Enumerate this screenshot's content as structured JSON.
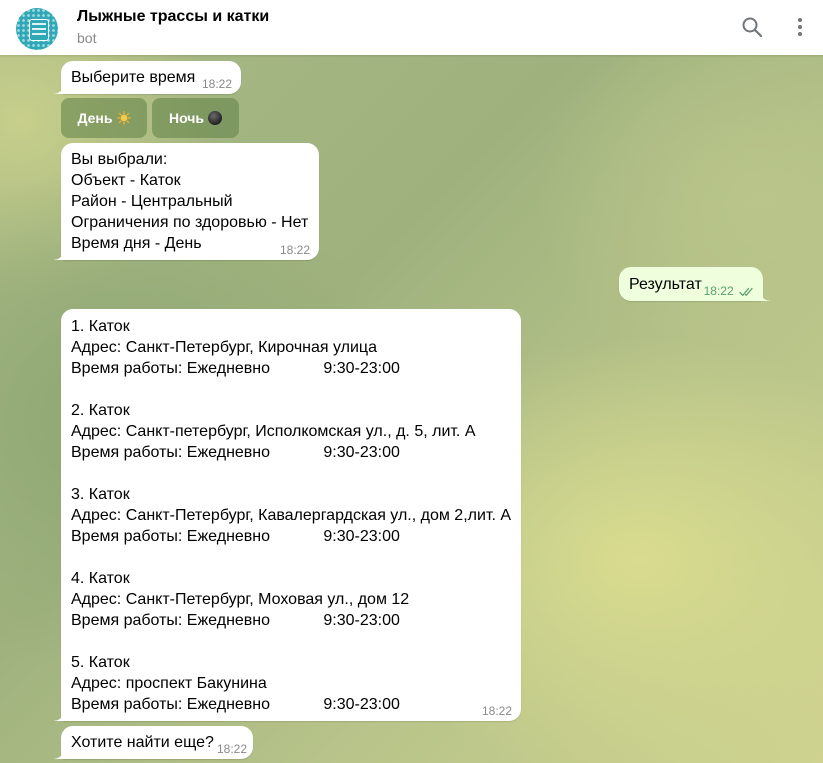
{
  "header": {
    "title": "Лыжные трассы и катки",
    "subtitle": "bot",
    "icons": [
      "search-icon",
      "more-vertical-icon"
    ]
  },
  "messages": {
    "choose_time": {
      "text": "Выберите время",
      "time": "18:22"
    },
    "keyboard": {
      "day": "День",
      "night": "Ночь",
      "day_icon": "sun-icon",
      "night_icon": "new-moon-icon"
    },
    "summary": {
      "lines": [
        "Вы выбрали:",
        "Объект - Каток",
        "Район - Центральный",
        "Ограничения по здоровью - Нет",
        "Время дня - День"
      ],
      "time": "18:22"
    },
    "result": {
      "text": "Результат",
      "time": "18:22",
      "status": "read"
    },
    "list": {
      "lines": [
        "1. Каток",
        "Адрес: Санкт-Петербург, Кирочная улица",
        "Время работы: Ежедневно            9:30-23:00",
        "",
        "2. Каток",
        "Адрес: Санкт-петербург, Исполкомская ул., д. 5, лит. А",
        "Время работы: Ежедневно            9:30-23:00",
        "",
        "3. Каток",
        "Адрес: Санкт-Петербург, Кавалергардская ул., дом 2,лит. А",
        "Время работы: Ежедневно            9:30-23:00",
        "",
        "4. Каток",
        "Адрес: Санкт-Петербург, Моховая ул., дом 12",
        "Время работы: Ежедневно            9:30-23:00",
        "",
        "5. Каток",
        "Адрес: проспект Бакунина",
        "Время работы: Ежедневно            9:30-23:00"
      ],
      "time": "18:22"
    },
    "more": {
      "text": "Хотите найти еще?",
      "time": "18:22"
    }
  },
  "colors": {
    "incoming_bubble": "#ffffff",
    "outgoing_bubble": "#effedd",
    "read_check": "#5aa36b",
    "avatar": "#2fa9b8"
  }
}
